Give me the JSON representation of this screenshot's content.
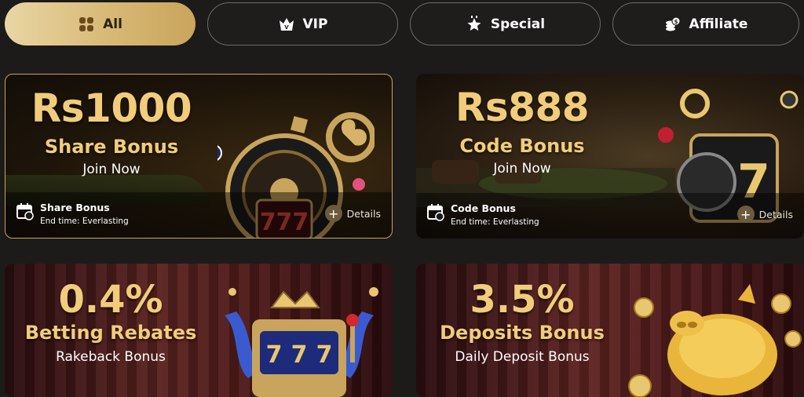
{
  "tabs": [
    {
      "label": "All",
      "icon": "clover-icon",
      "active": true
    },
    {
      "label": "VIP",
      "icon": "crown-icon",
      "active": false
    },
    {
      "label": "Special",
      "icon": "star-icon",
      "active": false
    },
    {
      "label": "Affiliate",
      "icon": "coin-stack-icon",
      "active": false
    }
  ],
  "cards": [
    {
      "amount": "Rs1000",
      "title": "Share Bonus",
      "subtitle": "Join Now",
      "footer_title": "Share Bonus",
      "end_time": "End time:    Everlasting",
      "details": "Details"
    },
    {
      "amount": "Rs888",
      "title": "Code Bonus",
      "subtitle": "Join Now",
      "footer_title": "Code Bonus",
      "end_time": "End time:    Everlasting",
      "details": "Details"
    },
    {
      "amount": "0.4%",
      "title": "Betting Rebates",
      "subtitle": "Rakeback Bonus"
    },
    {
      "amount": "3.5%",
      "title": "Deposits Bonus",
      "subtitle": "Daily Deposit Bonus"
    }
  ],
  "colors": {
    "gold": "#f1cd7b",
    "tab_active": "#d7b975",
    "background": "#1c1b1a"
  }
}
